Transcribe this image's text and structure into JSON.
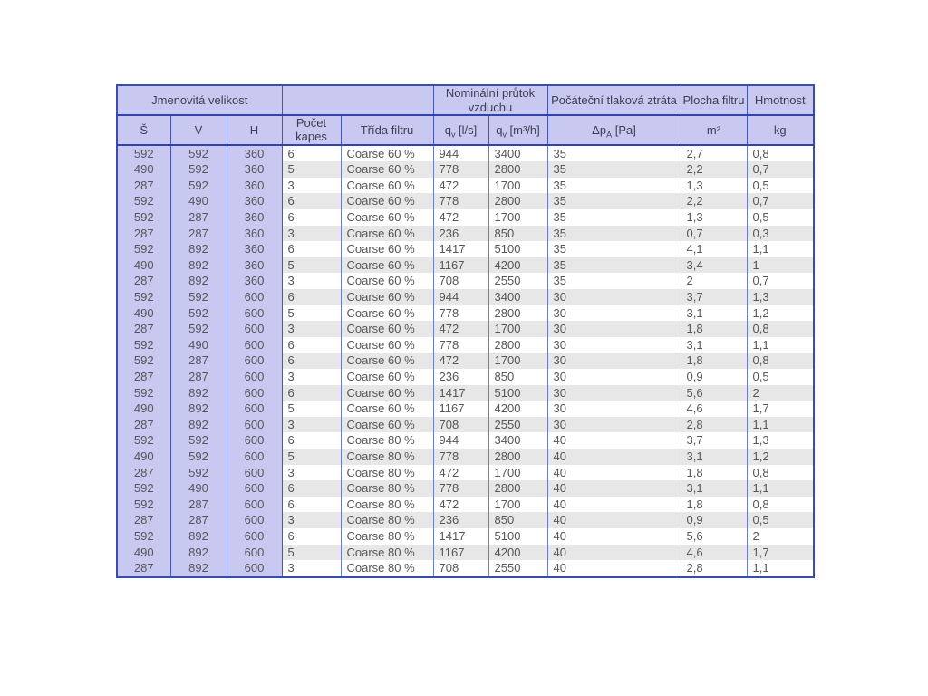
{
  "page": {
    "background": "#ffffff"
  },
  "table": {
    "colors": {
      "header_bg": "#c8c8f0",
      "dim_column_bg": "#c8c8f0",
      "stripe_bg": "#e7e7e7",
      "inner_border": "#6b7cc9",
      "header_border": "#4456b8",
      "outer_border": "#3b4cb0",
      "text": "#565658",
      "header_text": "#3e3e52"
    },
    "header": {
      "groups": {
        "size": "Jmenovitá velikost",
        "empty": "",
        "flow": "Nominální průtok vzduchu",
        "pressure": "Počáteční tlaková ztráta",
        "area": "Plocha filtru",
        "weight": "Hmotnost"
      },
      "sub": {
        "s": "Š",
        "v": "V",
        "h": "H",
        "pocet_kapes": "Počet kapes",
        "trida_filtru": "Třída filtru",
        "q_ls": {
          "base": "q",
          "sub": "v",
          "unit": " [l/s]"
        },
        "q_m3h": {
          "base": "q",
          "sub": "v",
          "unit": " [m³/h]"
        },
        "dp": {
          "base": "Δp",
          "sub": "A",
          "unit": " [Pa]"
        },
        "m2": "m²",
        "kg": "kg"
      }
    },
    "columns": [
      "s",
      "v",
      "h",
      "pocet_kapes",
      "trida_filtru",
      "q_ls",
      "q_m3h",
      "dp_pa",
      "plocha_m2",
      "hmotnost_kg"
    ],
    "rows": [
      [
        "592",
        "592",
        "360",
        "6",
        "Coarse 60 %",
        "944",
        "3400",
        "35",
        "2,7",
        "0,8"
      ],
      [
        "490",
        "592",
        "360",
        "5",
        "Coarse 60 %",
        "778",
        "2800",
        "35",
        "2,2",
        "0,7"
      ],
      [
        "287",
        "592",
        "360",
        "3",
        "Coarse 60 %",
        "472",
        "1700",
        "35",
        "1,3",
        "0,5"
      ],
      [
        "592",
        "490",
        "360",
        "6",
        "Coarse 60 %",
        "778",
        "2800",
        "35",
        "2,2",
        "0,7"
      ],
      [
        "592",
        "287",
        "360",
        "6",
        "Coarse 60 %",
        "472",
        "1700",
        "35",
        "1,3",
        "0,5"
      ],
      [
        "287",
        "287",
        "360",
        "3",
        "Coarse 60 %",
        "236",
        "850",
        "35",
        "0,7",
        "0,3"
      ],
      [
        "592",
        "892",
        "360",
        "6",
        "Coarse 60 %",
        "1417",
        "5100",
        "35",
        "4,1",
        "1,1"
      ],
      [
        "490",
        "892",
        "360",
        "5",
        "Coarse 60 %",
        "1167",
        "4200",
        "35",
        "3,4",
        "1"
      ],
      [
        "287",
        "892",
        "360",
        "3",
        "Coarse 60 %",
        "708",
        "2550",
        "35",
        "2",
        "0,7"
      ],
      [
        "592",
        "592",
        "600",
        "6",
        "Coarse 60 %",
        "944",
        "3400",
        "30",
        "3,7",
        "1,3"
      ],
      [
        "490",
        "592",
        "600",
        "5",
        "Coarse 60 %",
        "778",
        "2800",
        "30",
        "3,1",
        "1,2"
      ],
      [
        "287",
        "592",
        "600",
        "3",
        "Coarse 60 %",
        "472",
        "1700",
        "30",
        "1,8",
        "0,8"
      ],
      [
        "592",
        "490",
        "600",
        "6",
        "Coarse 60 %",
        "778",
        "2800",
        "30",
        "3,1",
        "1,1"
      ],
      [
        "592",
        "287",
        "600",
        "6",
        "Coarse 60 %",
        "472",
        "1700",
        "30",
        "1,8",
        "0,8"
      ],
      [
        "287",
        "287",
        "600",
        "3",
        "Coarse 60 %",
        "236",
        "850",
        "30",
        "0,9",
        "0,5"
      ],
      [
        "592",
        "892",
        "600",
        "6",
        "Coarse 60 %",
        "1417",
        "5100",
        "30",
        "5,6",
        "2"
      ],
      [
        "490",
        "892",
        "600",
        "5",
        "Coarse 60 %",
        "1167",
        "4200",
        "30",
        "4,6",
        "1,7"
      ],
      [
        "287",
        "892",
        "600",
        "3",
        "Coarse 60 %",
        "708",
        "2550",
        "30",
        "2,8",
        "1,1"
      ],
      [
        "592",
        "592",
        "600",
        "6",
        "Coarse 80 %",
        "944",
        "3400",
        "40",
        "3,7",
        "1,3"
      ],
      [
        "490",
        "592",
        "600",
        "5",
        "Coarse 80 %",
        "778",
        "2800",
        "40",
        "3,1",
        "1,2"
      ],
      [
        "287",
        "592",
        "600",
        "3",
        "Coarse 80 %",
        "472",
        "1700",
        "40",
        "1,8",
        "0,8"
      ],
      [
        "592",
        "490",
        "600",
        "6",
        "Coarse 80 %",
        "778",
        "2800",
        "40",
        "3,1",
        "1,1"
      ],
      [
        "592",
        "287",
        "600",
        "6",
        "Coarse 80 %",
        "472",
        "1700",
        "40",
        "1,8",
        "0,8"
      ],
      [
        "287",
        "287",
        "600",
        "3",
        "Coarse 80 %",
        "236",
        "850",
        "40",
        "0,9",
        "0,5"
      ],
      [
        "592",
        "892",
        "600",
        "6",
        "Coarse 80 %",
        "1417",
        "5100",
        "40",
        "5,6",
        "2"
      ],
      [
        "490",
        "892",
        "600",
        "5",
        "Coarse 80 %",
        "1167",
        "4200",
        "40",
        "4,6",
        "1,7"
      ],
      [
        "287",
        "892",
        "600",
        "3",
        "Coarse 80 %",
        "708",
        "2550",
        "40",
        "2,8",
        "1,1"
      ]
    ]
  }
}
